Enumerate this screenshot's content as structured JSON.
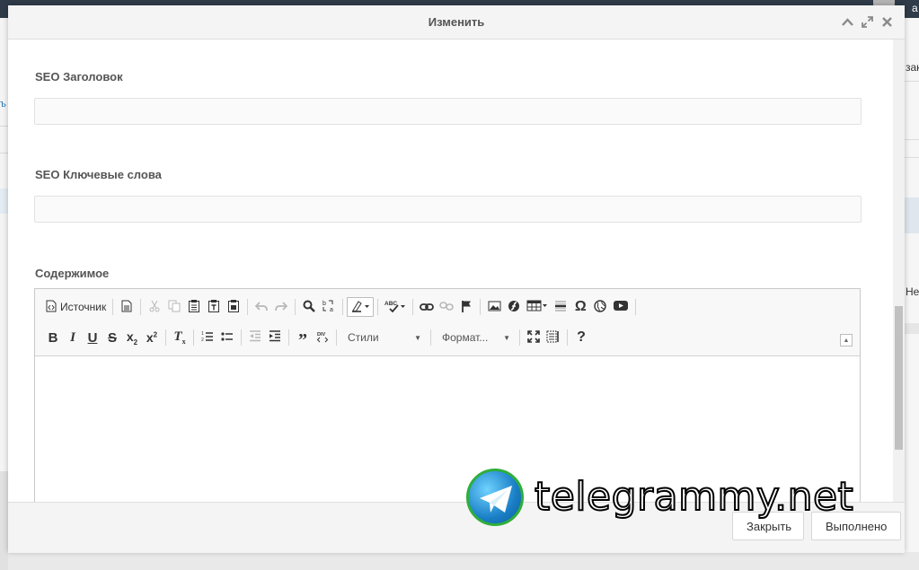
{
  "background": {
    "left_link": "ъ",
    "right_texts": [
      "закр",
      "Нет"
    ],
    "top_right_letter": "a"
  },
  "dialog": {
    "title": "Изменить",
    "fields": {
      "seo_title_label": "SEO Заголовок",
      "seo_title_value": "",
      "seo_keywords_label": "SEO Ключевые слова",
      "seo_keywords_value": "",
      "content_label": "Содержимое"
    },
    "editor": {
      "source_label": "Источник",
      "styles_combo": "Стили",
      "format_combo": "Формат...",
      "content": ""
    },
    "footer": {
      "close_label": "Закрыть",
      "done_label": "Выполнено"
    }
  },
  "watermark": {
    "text": "telegrammy.net"
  },
  "icons": {
    "header": [
      "chevron-up-icon",
      "maximize-icon",
      "close-icon"
    ],
    "toolbar_row1": [
      "source-icon",
      "new-page-icon",
      "cut-icon",
      "copy-icon",
      "paste-icon",
      "paste-text-icon",
      "paste-word-icon",
      "undo-icon",
      "redo-icon",
      "find-icon",
      "replace-icon",
      "highlight-icon",
      "spellcheck-icon",
      "link-icon",
      "unlink-icon",
      "anchor-icon",
      "image-icon",
      "flash-icon",
      "table-icon",
      "horizontal-rule-icon",
      "special-char-icon",
      "iframe-icon",
      "youtube-icon"
    ],
    "toolbar_row2": [
      "bold-icon",
      "italic-icon",
      "underline-icon",
      "strike-icon",
      "subscript-icon",
      "superscript-icon",
      "remove-format-icon",
      "numbered-list-icon",
      "bullet-list-icon",
      "outdent-icon",
      "indent-icon",
      "blockquote-icon",
      "div-icon",
      "maximize-icon",
      "show-blocks-icon",
      "help-icon"
    ]
  },
  "colors": {
    "header_bg": "#f4f4f4",
    "topbar_bg": "#2f3b48",
    "watermark_ring": "#2fae3c"
  }
}
